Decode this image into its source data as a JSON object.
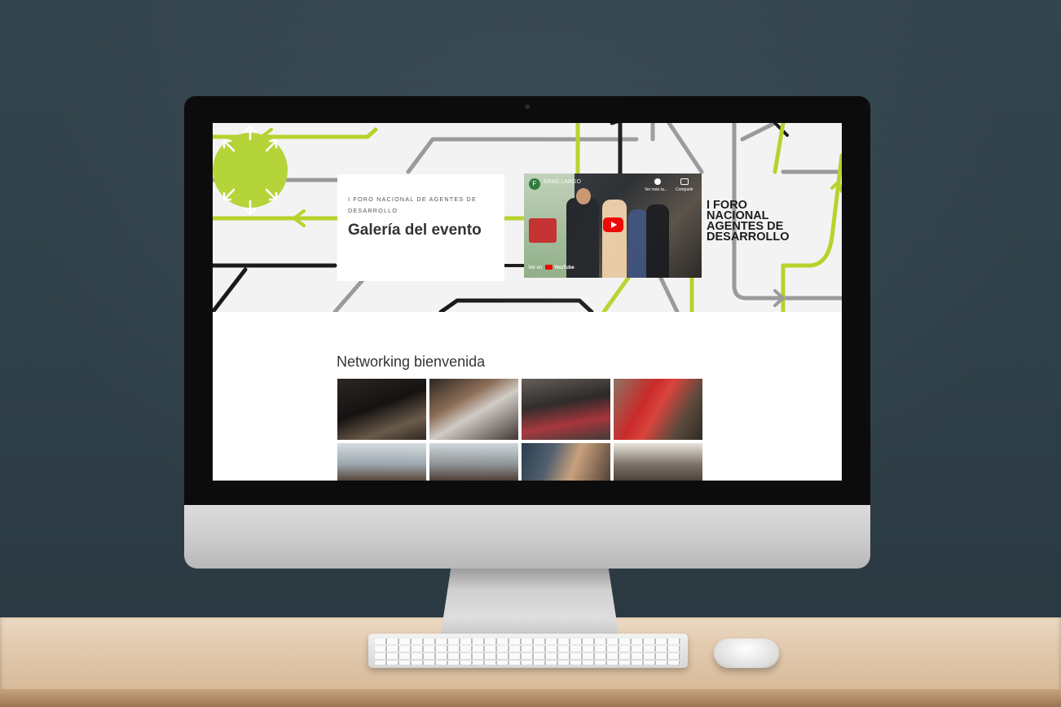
{
  "hero": {
    "kicker": "I FORO NACIONAL DE AGENTES DE DESARROLLO",
    "title": "Galería del evento"
  },
  "video": {
    "channel_badge": "F",
    "title": "ERAD LARGO",
    "watch_later": "Ver más ta...",
    "share": "Compartir",
    "watch_on": "Ver en",
    "brand": "YouTube"
  },
  "logo": {
    "lines": [
      "I FORO",
      "NACIONAL",
      "AGENTES DE",
      "DESARROLLO"
    ],
    "accent": "#b5d43a"
  },
  "section": {
    "heading": "Networking bienvenida"
  },
  "colors": {
    "accent_green": "#b6d32c",
    "line_gray": "#9a9a9a",
    "line_black": "#1a1a1a"
  }
}
